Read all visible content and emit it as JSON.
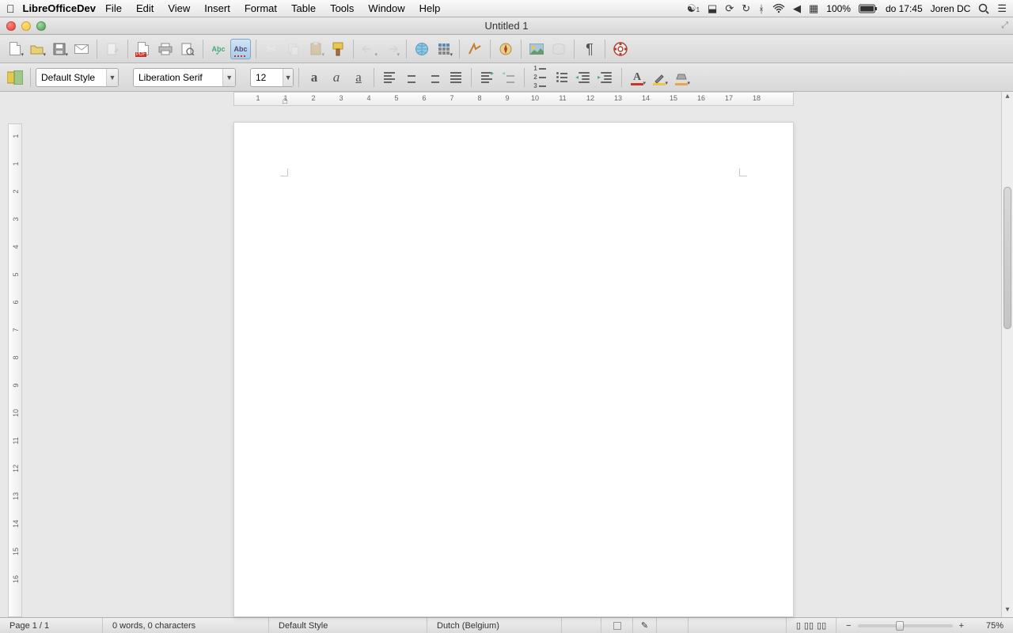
{
  "menubar": {
    "appname": "LibreOfficeDev",
    "items": [
      "File",
      "Edit",
      "View",
      "Insert",
      "Format",
      "Table",
      "Tools",
      "Window",
      "Help"
    ],
    "right": {
      "notify_count": "1",
      "battery": "100%",
      "datetime": "do 17:45",
      "user": "Joren DC"
    }
  },
  "window": {
    "title": "Untitled 1"
  },
  "formatbar": {
    "style": "Default Style",
    "font": "Liberation Serif",
    "size": "12"
  },
  "ruler_h": [
    "1",
    "1",
    "2",
    "3",
    "4",
    "5",
    "6",
    "7",
    "8",
    "9",
    "10",
    "11",
    "12",
    "13",
    "14",
    "15",
    "16",
    "17",
    "18"
  ],
  "ruler_v": [
    "1",
    "1",
    "2",
    "3",
    "4",
    "5",
    "6",
    "7",
    "8",
    "9",
    "10",
    "11",
    "12",
    "13",
    "14",
    "15",
    "16"
  ],
  "status": {
    "page": "Page 1 / 1",
    "words": "0 words, 0 characters",
    "style": "Default Style",
    "lang": "Dutch (Belgium)",
    "zoom": "75%"
  }
}
